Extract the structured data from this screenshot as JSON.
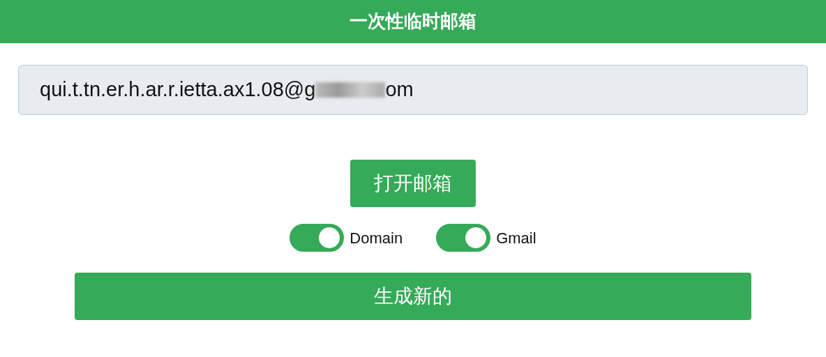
{
  "header": {
    "title": "一次性临时邮箱"
  },
  "email_field": {
    "value_start": "qui.t.tn.er.h.ar.r.ietta.ax1.08@g",
    "value_end": "om"
  },
  "open_button": {
    "label": "打开邮箱"
  },
  "toggles": [
    {
      "label": "Domain",
      "on": true
    },
    {
      "label": "Gmail",
      "on": true
    }
  ],
  "generate_button": {
    "label": "生成新的"
  }
}
